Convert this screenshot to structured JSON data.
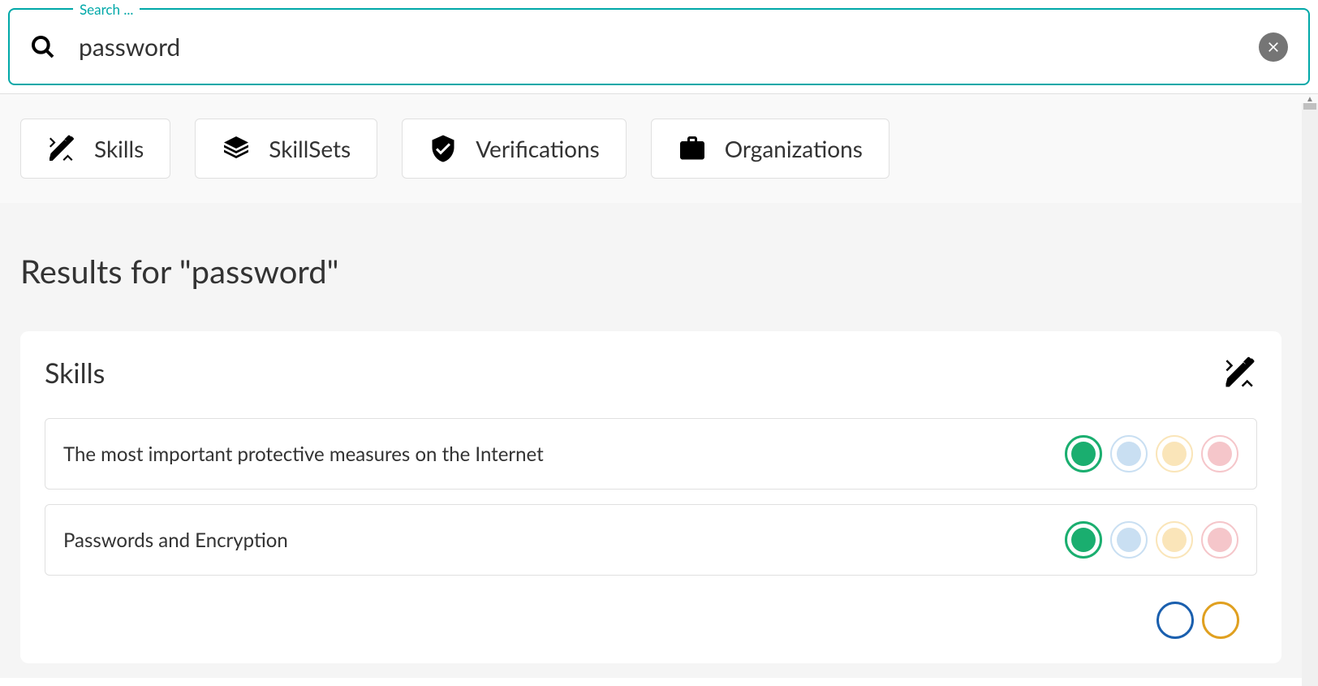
{
  "search": {
    "label": "Search ...",
    "value": "password"
  },
  "filterTabs": [
    {
      "label": "Skills",
      "icon": "design-tools-icon"
    },
    {
      "label": "SkillSets",
      "icon": "layers-icon"
    },
    {
      "label": "Verifications",
      "icon": "shield-check-icon"
    },
    {
      "label": "Organizations",
      "icon": "briefcase-icon"
    }
  ],
  "results": {
    "heading": "Results for \"password\"",
    "card": {
      "title": "Skills",
      "icon": "design-tools-icon",
      "items": [
        {
          "title": "The most important protective measures on the Internet",
          "status": [
            "green-active",
            "blue",
            "yellow",
            "red"
          ]
        },
        {
          "title": "Passwords and Encryption",
          "status": [
            "green-active",
            "blue",
            "yellow",
            "red"
          ]
        }
      ]
    }
  }
}
